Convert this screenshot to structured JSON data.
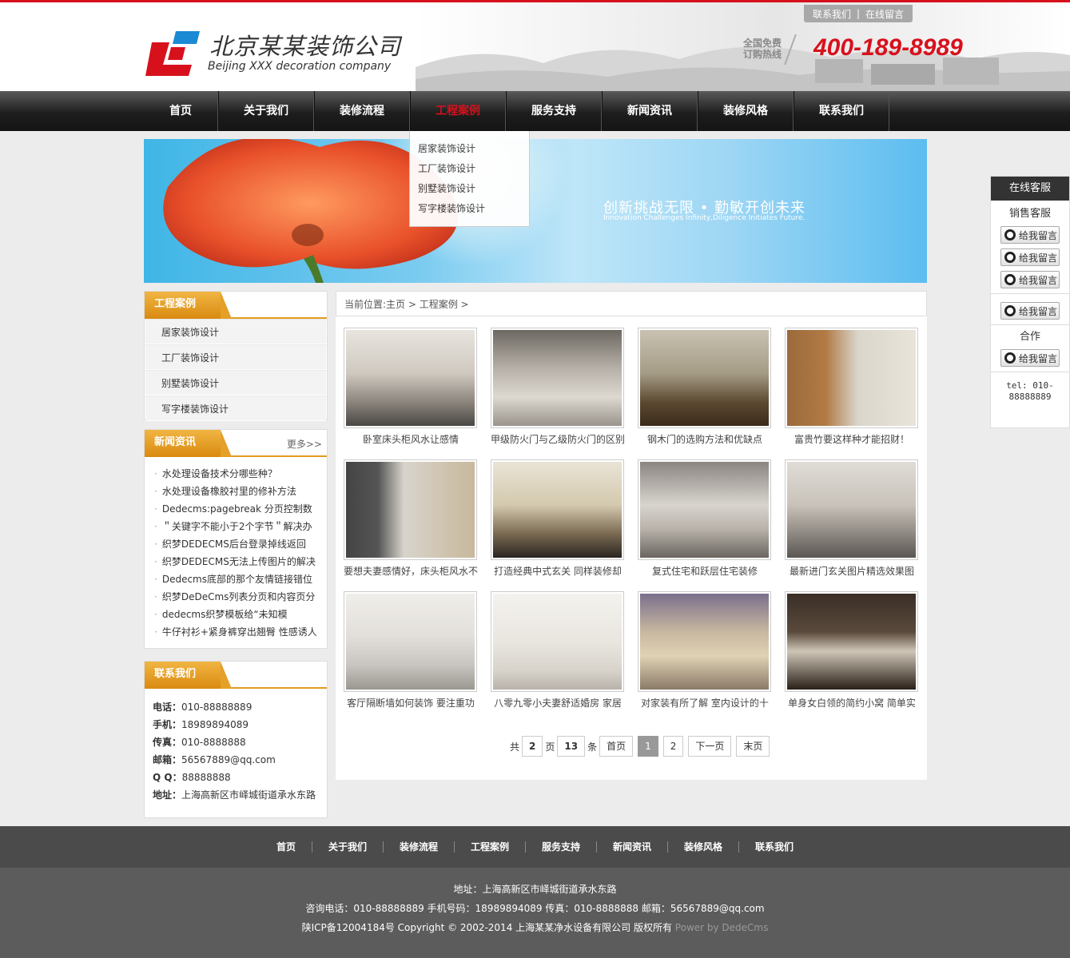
{
  "header": {
    "top_links": [
      "联系我们",
      "在线留言"
    ],
    "company_cn": "北京某某装饰公司",
    "company_en": "Beijing XXX decoration company",
    "hotline_label_1": "全国免费",
    "hotline_label_2": "订购热线",
    "hotline": "400-189-8989",
    "brand_color": "#d7111c"
  },
  "nav": {
    "items": [
      "首页",
      "关于我们",
      "装修流程",
      "工程案例",
      "服务支持",
      "新闻资讯",
      "装修风格",
      "联系我们"
    ],
    "active_index": 3,
    "dropdown": [
      "居家装饰设计",
      "工厂装饰设计",
      "别墅装饰设计",
      "写字楼装饰设计"
    ]
  },
  "banner": {
    "slogan": "创新挑战无限 • 勤敏开创未来",
    "slogan_en": "Innovation Challenges Infinity,Diligence Initiates Future."
  },
  "sidebar": {
    "cases": {
      "title": "工程案例",
      "items": [
        "居家装饰设计",
        "工厂装饰设计",
        "别墅装饰设计",
        "写字楼装饰设计"
      ]
    },
    "news": {
      "title": "新闻资讯",
      "more": "更多>>",
      "items": [
        "水处理设备技术分哪些种？",
        "水处理设备橡胶衬里的修补方法",
        "Dedecms:pagebreak 分页控制数",
        "＂关键字不能小于2个字节＂解决办",
        "织梦DEDECMS后台登录掉线返回",
        "织梦DEDECMS无法上传图片的解决",
        "Dedecms底部的那个友情链接错位",
        "织梦DeDeCms列表分页和内容页分",
        "dedecms织梦模板给“未知模",
        "牛仔衬衫+紧身裤穿出翘臀 性感诱人"
      ]
    },
    "contact": {
      "title": "联系我们",
      "rows": [
        {
          "k": "电话：",
          "v": "010-88888889"
        },
        {
          "k": "手机：",
          "v": "18989894089"
        },
        {
          "k": "传真：",
          "v": "010-8888888"
        },
        {
          "k": "邮箱：",
          "v": "56567889@qq.com"
        },
        {
          "k": "Q Q：",
          "v": "88888888"
        },
        {
          "k": "地址：",
          "v": "上海高新区市峄城街道承水东路"
        }
      ]
    }
  },
  "main": {
    "breadcrumb": "当前位置:主页 > 工程案例 >",
    "cases": [
      "卧室床头柜风水让感情",
      "甲级防火门与乙级防火门的区别",
      "钢木门的选购方法和优缺点",
      "富贵竹要这样种才能招财！",
      "要想夫妻感情好，床头柜风水不",
      "打造经典中式玄关 同样装修却",
      "复式住宅和跃层住宅装修",
      "最新进门玄关图片精选效果图",
      "客厅隔断墙如何装饰 要注重功",
      "八零九零小夫妻舒适婚房 家居",
      "对家装有所了解 室内设计的十",
      "单身女白领的简约小窝 简单实"
    ],
    "pager": {
      "total_label": "共",
      "pages": "2",
      "page_unit": "页",
      "count": "13",
      "count_unit": "条",
      "first": "首页",
      "page_numbers": [
        "1",
        "2"
      ],
      "current": "1",
      "next": "下一页",
      "last": "末页"
    }
  },
  "service": {
    "title": "在线客服",
    "sales_label": "销售客服",
    "qq_label": "给我留言",
    "coop_label": "合作",
    "tel_1": "tel: 010-",
    "tel_2": "88888889"
  },
  "footer": {
    "nav": [
      "首页",
      "关于我们",
      "装修流程",
      "工程案例",
      "服务支持",
      "新闻资讯",
      "装修风格",
      "联系我们"
    ],
    "address": "地址：上海高新区市峄城街道承水东路",
    "phones": "咨询电话：010-88888889 手机号码：18989894089 传真：010-8888888 邮箱：56567889@qq.com",
    "copyright": "陕ICP备12004184号 Copyright © 2002-2014 上海某某净水设备有限公司 版权所有",
    "powered": "Power by DedeCms"
  }
}
